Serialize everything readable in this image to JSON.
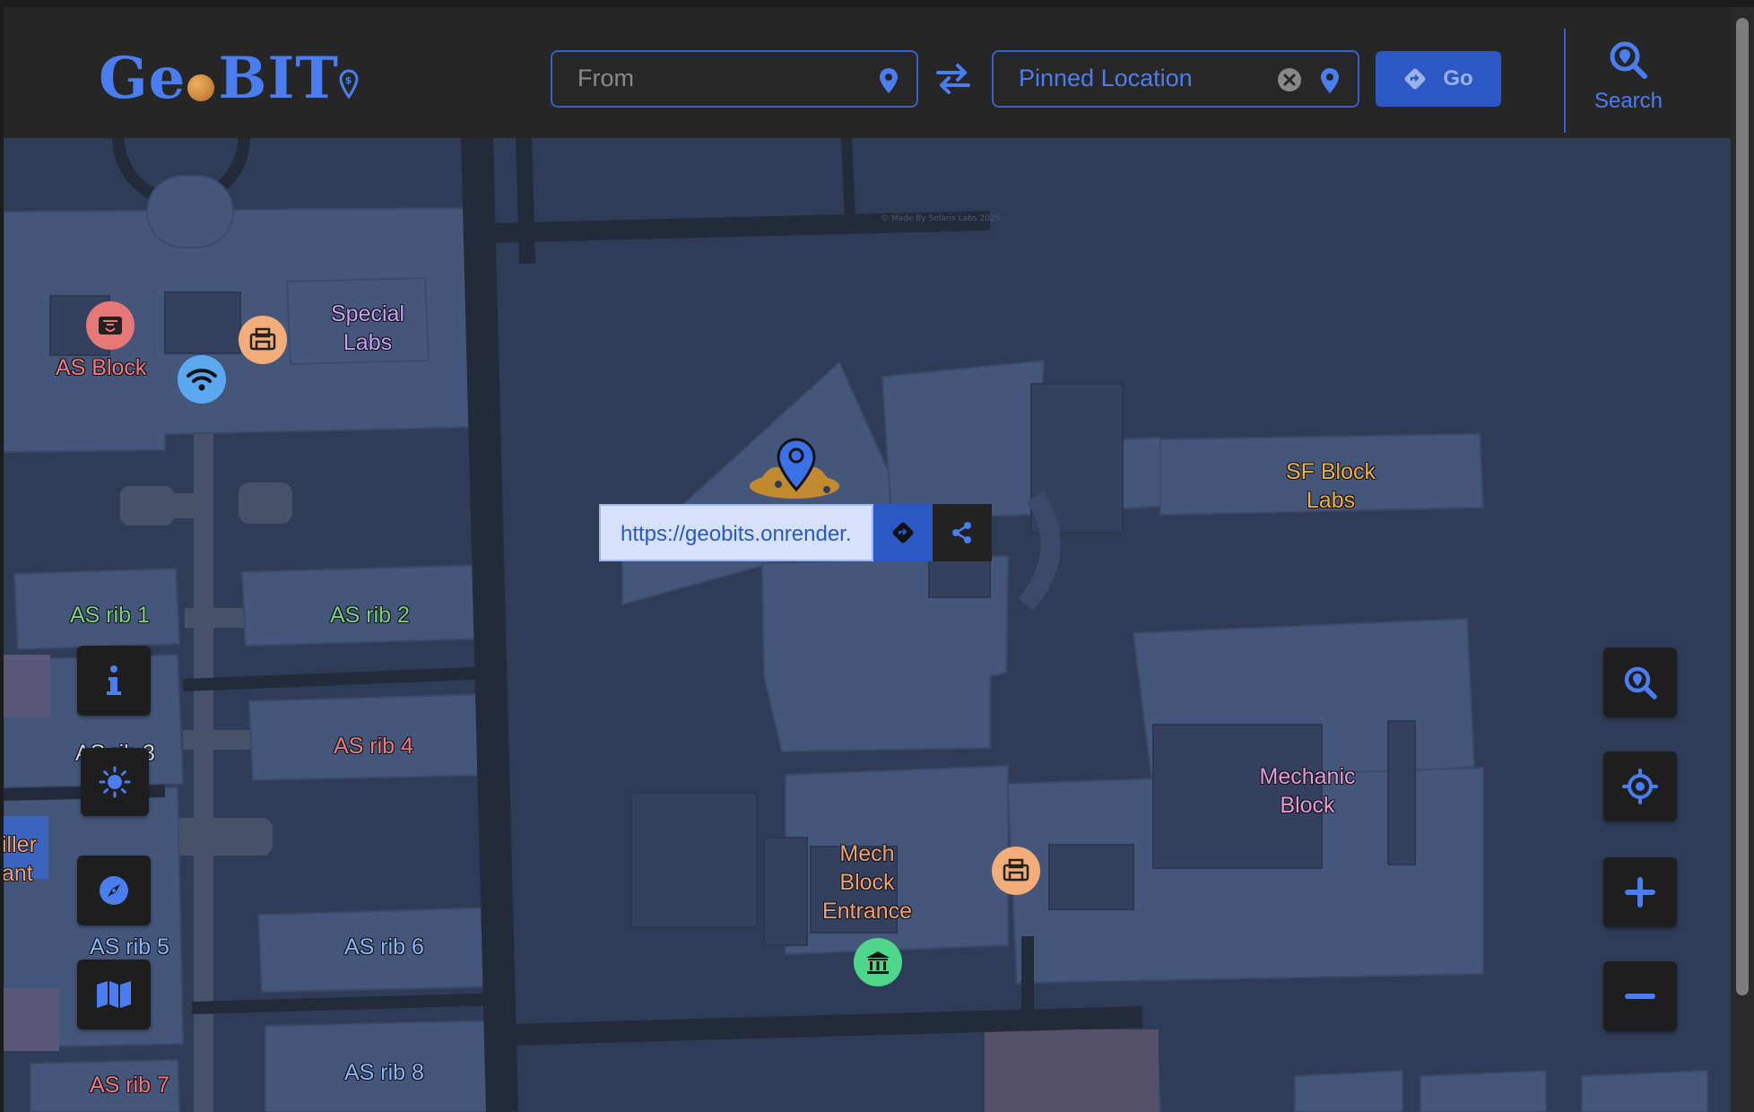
{
  "app": {
    "name": "GeoBIT",
    "logo_left": "Ge",
    "logo_right": "BIT"
  },
  "header": {
    "from_placeholder": "From",
    "to_value": "Pinned Location",
    "go_label": "Go",
    "search_label": "Search"
  },
  "share": {
    "url": "https://geobits.onrender."
  },
  "map": {
    "attribution": "© Made By Solaris Labs 2025",
    "labels": {
      "as_block": "AS Block",
      "special_labs": "Special Labs",
      "sf_block_labs": "SF Block Labs",
      "as_rib_1": "AS rib 1",
      "as_rib_2": "AS rib 2",
      "as_rib_3": "AS rib 3",
      "as_rib_4": "AS rib 4",
      "as_rib_5": "AS rib 5",
      "as_rib_6": "AS rib 6",
      "as_rib_7": "AS rib 7",
      "as_rib_8": "AS rib 8",
      "mechanic_block": "Mechanic Block",
      "mech_block_entrance": "Mech Block Entrance",
      "partial_label": "iller ant"
    },
    "poi_icons": [
      "cafe-icon",
      "printer-icon",
      "wifi-icon",
      "museum-icon"
    ]
  },
  "controls": {
    "left": [
      "info-icon",
      "sun-icon",
      "compass-icon",
      "map-icon"
    ],
    "right": [
      "zoom-search-icon",
      "locate-icon",
      "plus-icon",
      "minus-icon"
    ]
  },
  "colors": {
    "accent": "#4a7ef0",
    "header_bg": "#262626",
    "map_bg": "#2f3c58",
    "building": "#44577a",
    "road": "#232b3b"
  }
}
